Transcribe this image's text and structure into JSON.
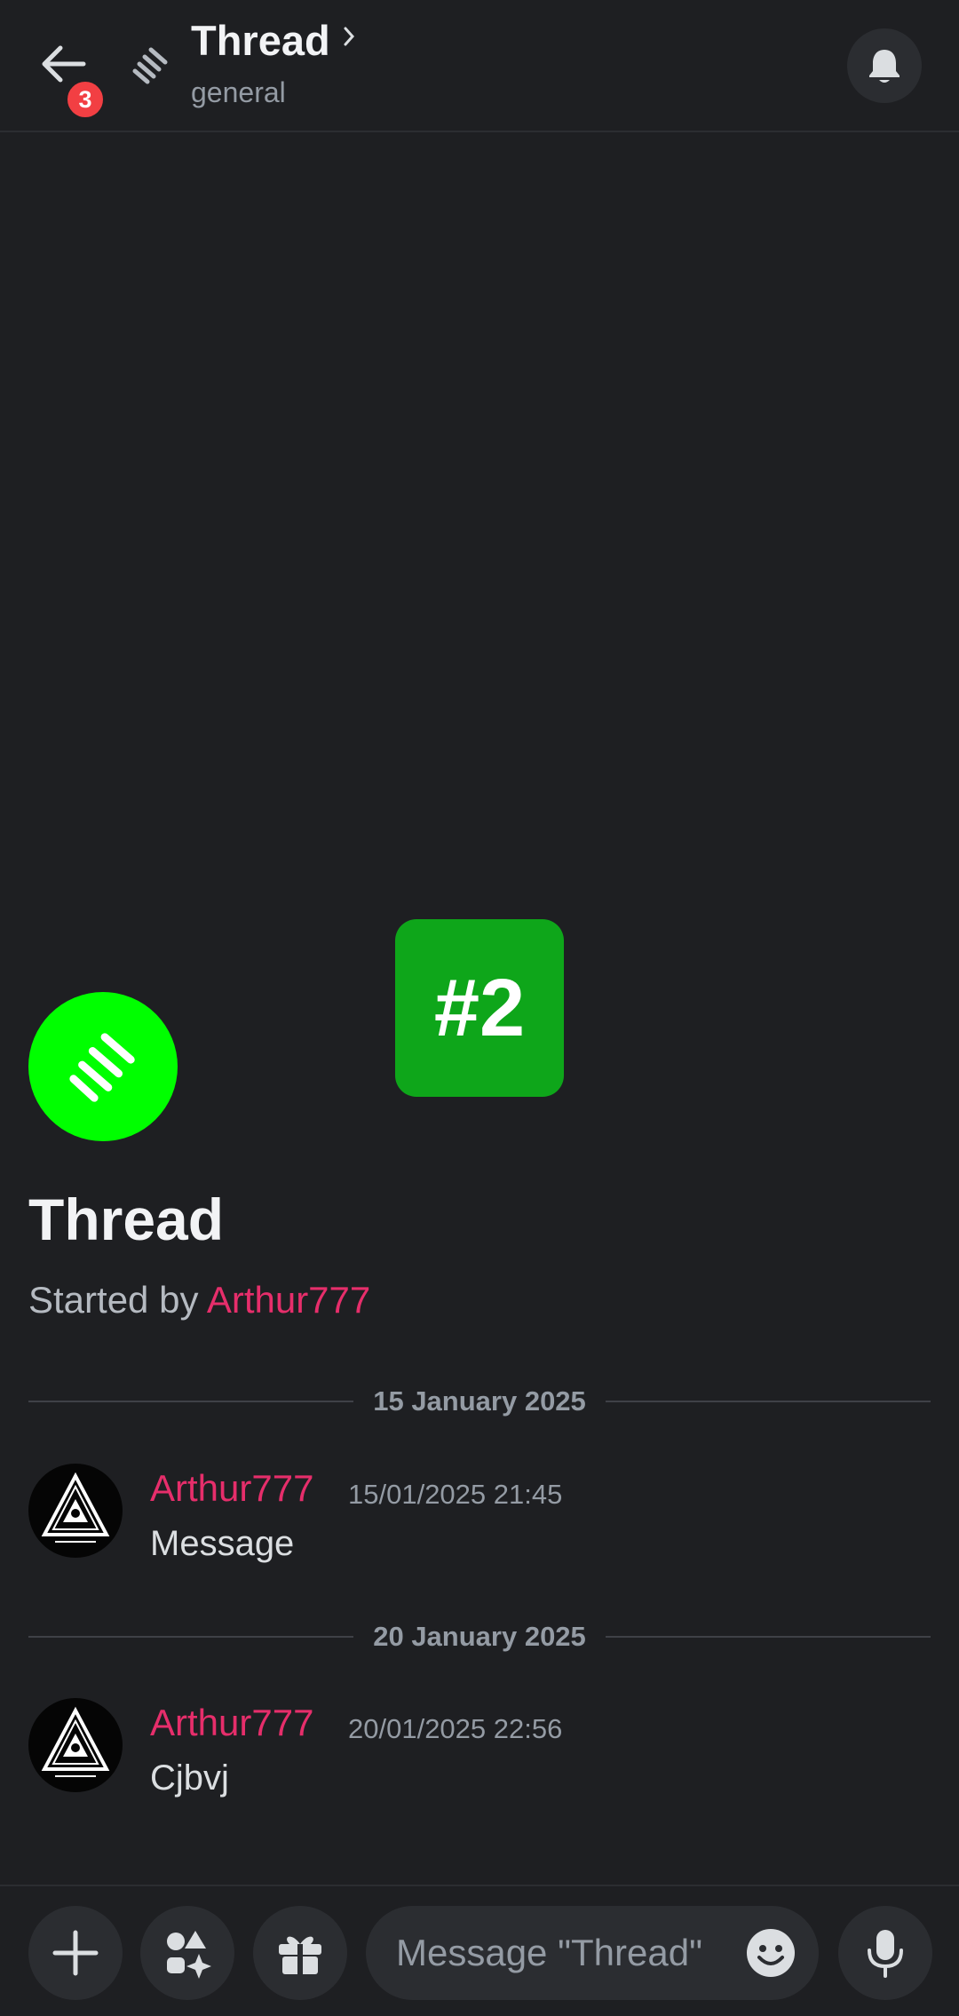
{
  "header": {
    "title": "Thread",
    "subtitle": "general",
    "unread_badge": "3",
    "back_icon": "arrow-left-icon",
    "bell_icon": "bell-icon",
    "chevron_icon": "chevron-right-icon"
  },
  "overlay": {
    "tag": "#2"
  },
  "thread": {
    "title": "Thread",
    "started_prefix": "Started by",
    "author": "Arthur777",
    "avatar_color": "#00ff00"
  },
  "dividers": [
    {
      "label": "15 January 2025"
    },
    {
      "label": "20 January 2025"
    }
  ],
  "messages": [
    {
      "author": "Arthur777",
      "timestamp": "15/01/2025 21:45",
      "text": "Message"
    },
    {
      "author": "Arthur777",
      "timestamp": "20/01/2025 22:56",
      "text": "Cjbvj"
    }
  ],
  "composer": {
    "placeholder": "Message \"Thread\"",
    "buttons": [
      "plus-icon",
      "apps-icon",
      "gift-icon",
      "emoji-icon",
      "microphone-icon"
    ]
  },
  "colors": {
    "background": "#1e1f22",
    "username": "#e62e6b",
    "badge": "#f23f43",
    "overlay": "#0ea61a"
  }
}
